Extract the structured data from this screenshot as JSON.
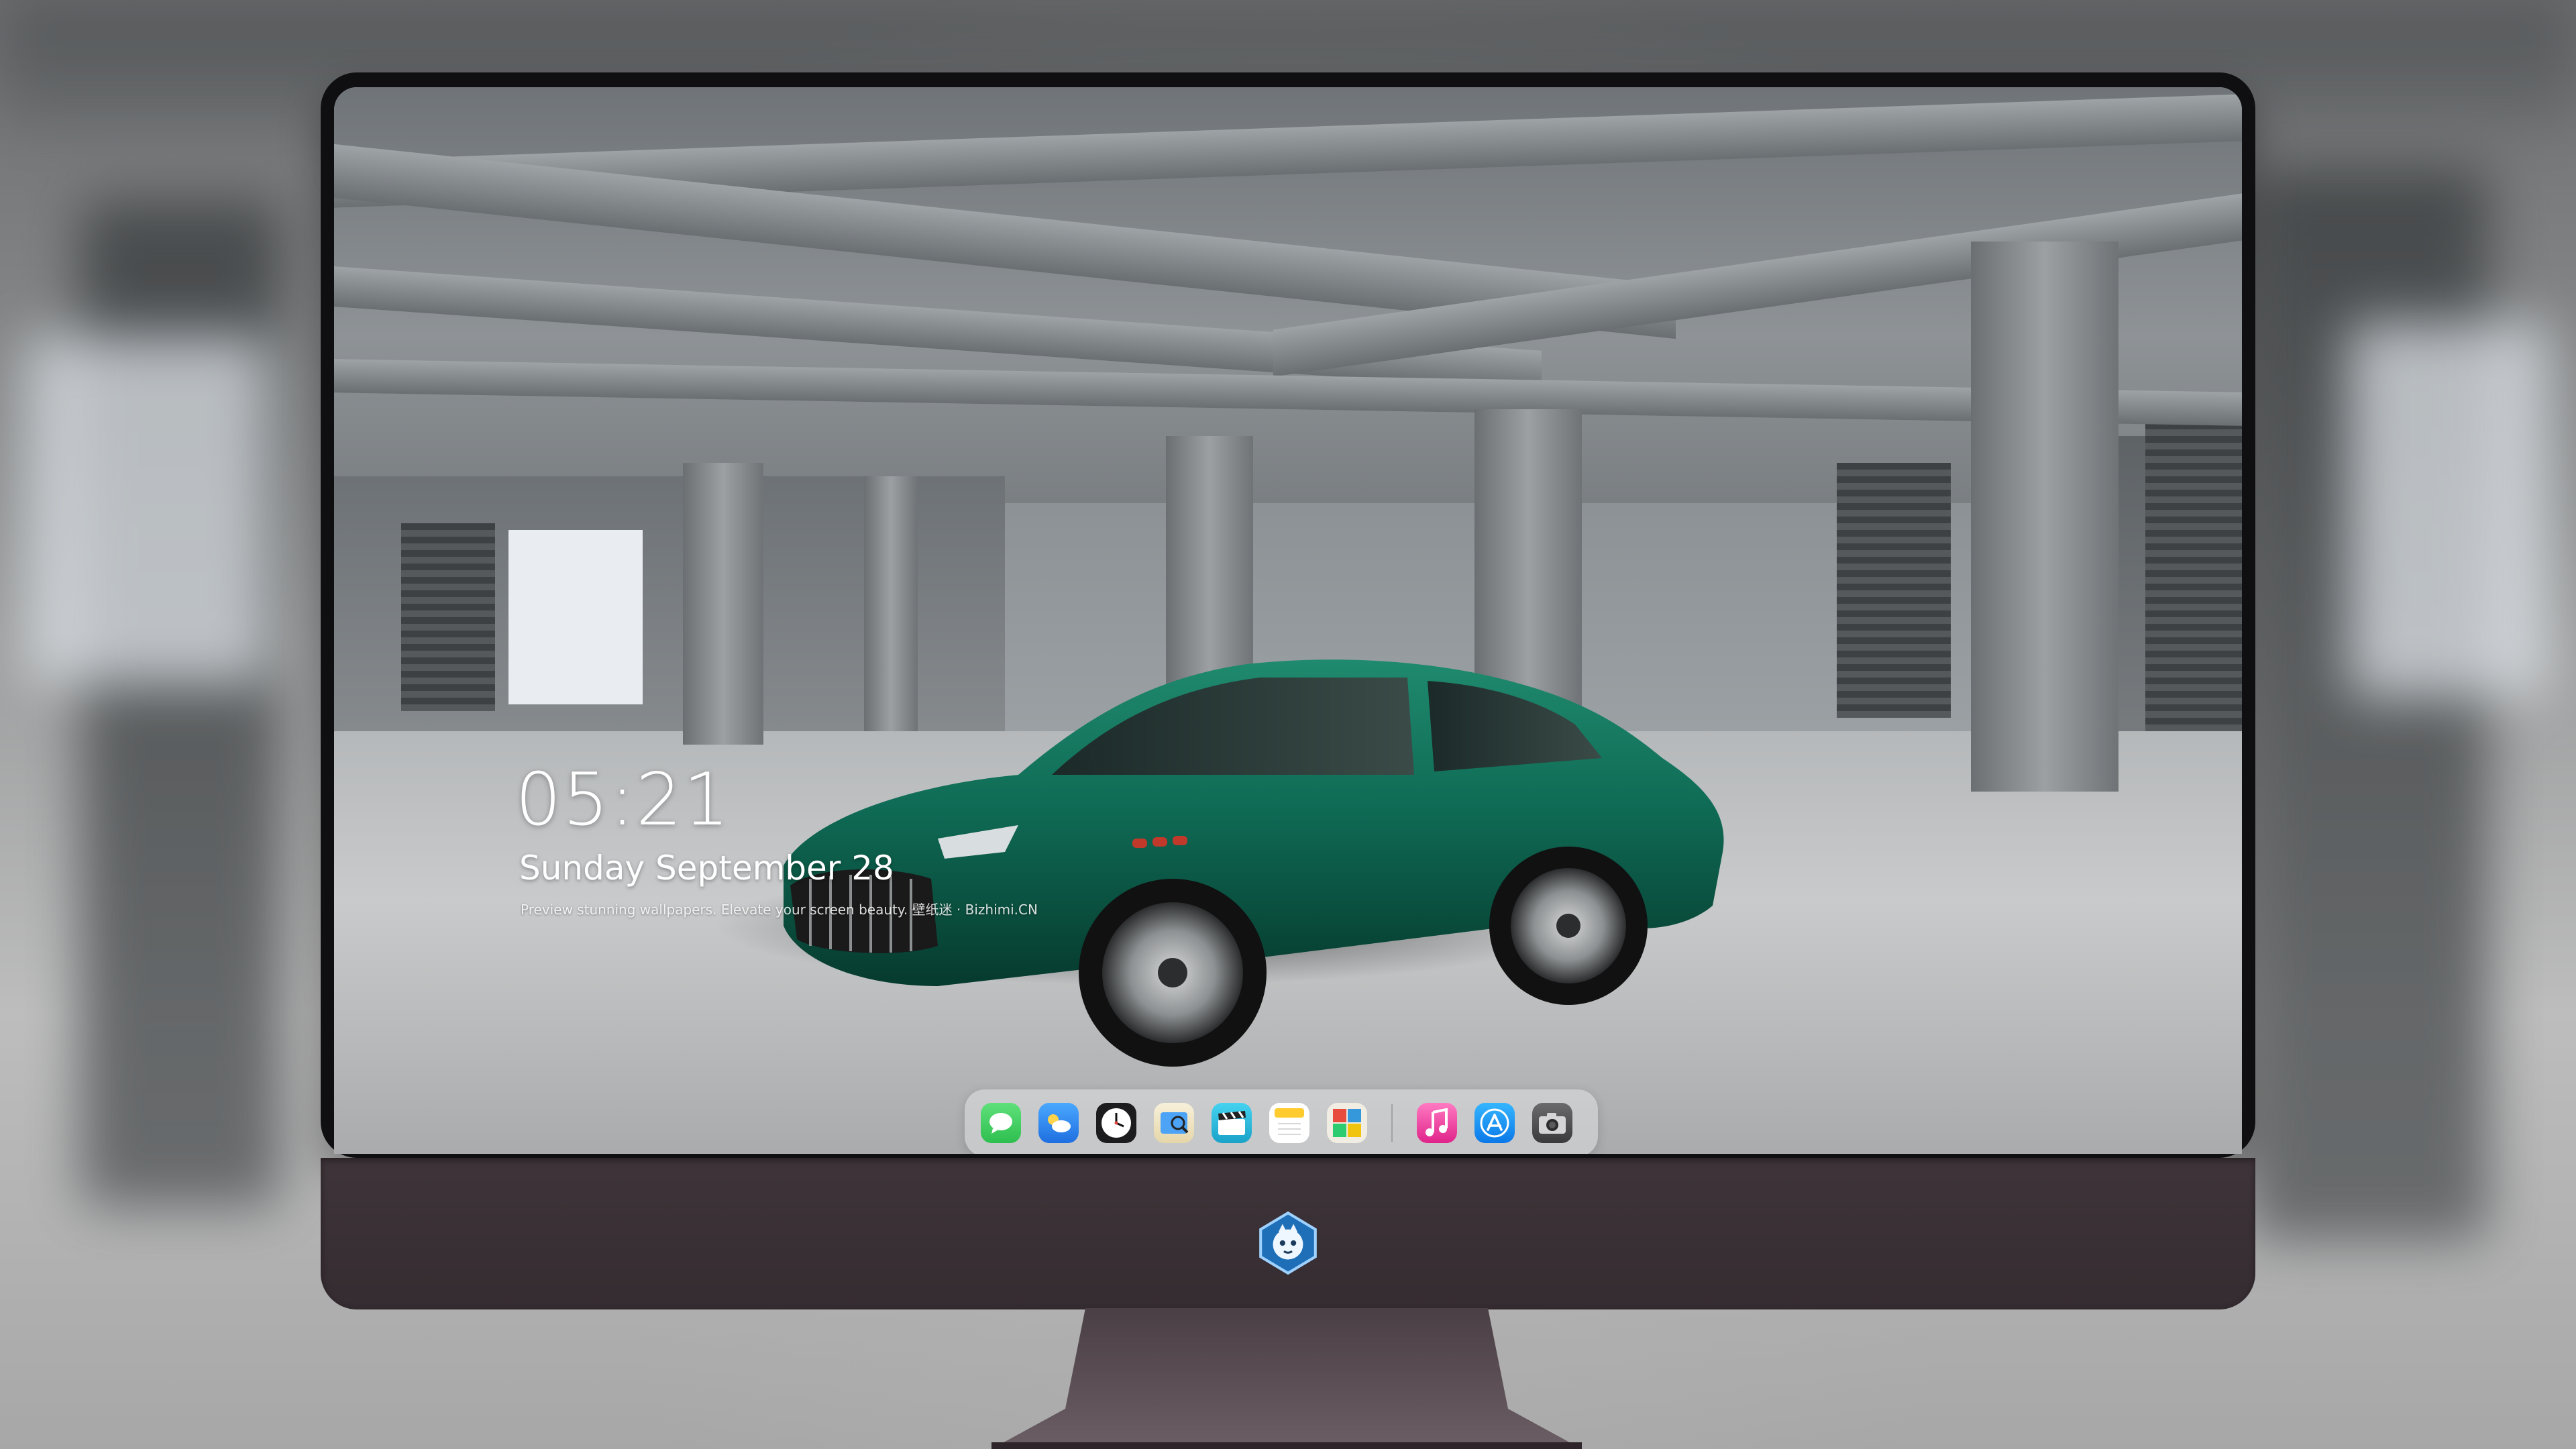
{
  "lockscreen": {
    "time": "05:21",
    "date": "Sunday September  28",
    "caption": "Preview stunning wallpapers. Elevate your screen beauty. 壁纸迷 · Bizhimi.CN"
  },
  "dock": {
    "apps": [
      {
        "name": "messages",
        "icon": "messages-icon",
        "color": "#34c759"
      },
      {
        "name": "weather",
        "icon": "weather-icon",
        "color": "#1e90ff"
      },
      {
        "name": "clock",
        "icon": "clock-icon",
        "color": "#ffffff"
      },
      {
        "name": "preview",
        "icon": "preview-icon",
        "color": "#f3c33b"
      },
      {
        "name": "clips",
        "icon": "clapperboard-icon",
        "color": "#2bb5d9"
      },
      {
        "name": "notes",
        "icon": "notes-icon",
        "color": "#ffd54a"
      },
      {
        "name": "photo-booth",
        "icon": "photo-booth-icon",
        "color": "#e9e4d6"
      },
      {
        "name": "music",
        "icon": "music-icon",
        "color": "#ff4fa3"
      },
      {
        "name": "app-store",
        "icon": "app-store-icon",
        "color": "#1aa1f5"
      },
      {
        "name": "camera",
        "icon": "camera-icon",
        "color": "#3a3a3c"
      }
    ]
  },
  "colors": {
    "car_body": "#0f6b55",
    "monitor_chin": "#3b3136",
    "bezel": "#0f0f12"
  }
}
